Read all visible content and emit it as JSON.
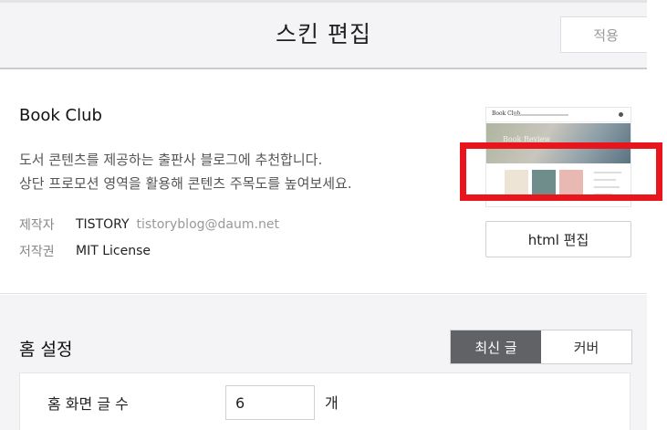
{
  "header": {
    "title": "스킨 편집",
    "apply_label": "적용"
  },
  "skin": {
    "name": "Book Club",
    "description_line1": "도서 콘텐츠를 제공하는 출판사 블로그에 추천합니다.",
    "description_line2": "상단 프로모션 영역을 활용해 콘텐츠 주목도를 높여보세요.",
    "author_label": "제작자",
    "author_name": "TISTORY",
    "author_email": "tistoryblog@daum.net",
    "license_label": "저작권",
    "license_value": "MIT License",
    "thumbnail": {
      "logo_text": "Book Club",
      "hero_text": "Book Review"
    },
    "html_edit_label": "html 편집"
  },
  "home": {
    "title": "홈 설정",
    "tabs": [
      {
        "label": "최신 글",
        "active": true
      },
      {
        "label": "커버",
        "active": false
      }
    ],
    "post_count_label": "홈 화면 글 수",
    "post_count_value": "6",
    "post_count_unit": "개"
  },
  "colors": {
    "highlight_border": "#e8161c",
    "active_tab": "#616266",
    "page_gray": "#f4f4f6"
  }
}
